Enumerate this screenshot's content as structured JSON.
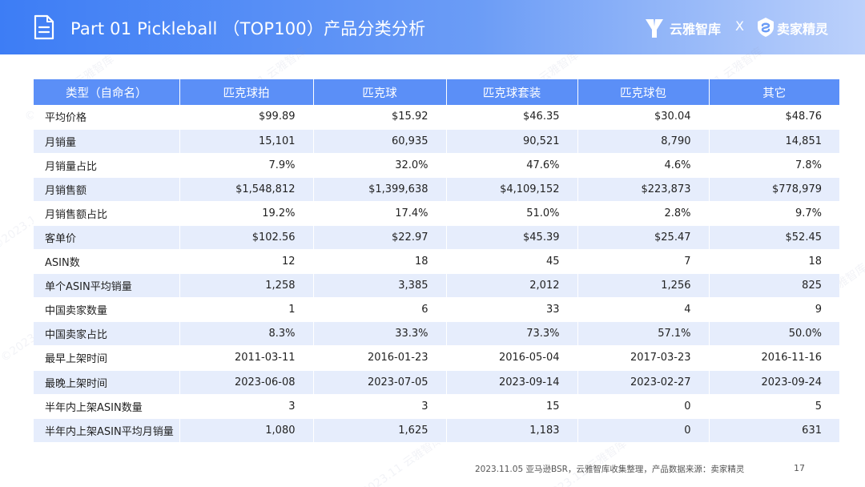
{
  "header": {
    "title": "Part 01 Pickleball （TOP100）产品分类分析",
    "brand_left": "云雅智库",
    "brand_sep": "X",
    "brand_right": "卖家精灵",
    "accent": "#3d7df5"
  },
  "watermark_text": "©2023.11 云雅智库",
  "table": {
    "header_color": "#5b8ff7",
    "stripe_color": "#e6edfc",
    "columns": [
      "类型（自命名）",
      "匹克球拍",
      "匹克球",
      "匹克球套装",
      "匹克球包",
      "其它"
    ],
    "rows": [
      {
        "label": "平均价格",
        "values": [
          "$99.89",
          "$15.92",
          "$46.35",
          "$30.04",
          "$48.76"
        ]
      },
      {
        "label": "月销量",
        "values": [
          "15,101",
          "60,935",
          "90,521",
          "8,790",
          "14,851"
        ]
      },
      {
        "label": "月销量占比",
        "values": [
          "7.9%",
          "32.0%",
          "47.6%",
          "4.6%",
          "7.8%"
        ]
      },
      {
        "label": "月销售额",
        "values": [
          "$1,548,812",
          "$1,399,638",
          "$4,109,152",
          "$223,873",
          "$778,979"
        ]
      },
      {
        "label": "月销售额占比",
        "values": [
          "19.2%",
          "17.4%",
          "51.0%",
          "2.8%",
          "9.7%"
        ]
      },
      {
        "label": "客单价",
        "values": [
          "$102.56",
          "$22.97",
          "$45.39",
          "$25.47",
          "$52.45"
        ]
      },
      {
        "label": "ASIN数",
        "values": [
          "12",
          "18",
          "45",
          "7",
          "18"
        ]
      },
      {
        "label": "单个ASIN平均销量",
        "values": [
          "1,258",
          "3,385",
          "2,012",
          "1,256",
          "825"
        ]
      },
      {
        "label": "中国卖家数量",
        "values": [
          "1",
          "6",
          "33",
          "4",
          "9"
        ]
      },
      {
        "label": "中国卖家占比",
        "values": [
          "8.3%",
          "33.3%",
          "73.3%",
          "57.1%",
          "50.0%"
        ]
      },
      {
        "label": "最早上架时间",
        "values": [
          "2011-03-11",
          "2016-01-23",
          "2016-05-04",
          "2017-03-23",
          "2016-11-16"
        ]
      },
      {
        "label": "最晚上架时间",
        "values": [
          "2023-06-08",
          "2023-07-05",
          "2023-09-14",
          "2023-02-27",
          "2023-09-24"
        ]
      },
      {
        "label": "半年内上架ASIN数量",
        "values": [
          "3",
          "3",
          "15",
          "0",
          "5"
        ]
      },
      {
        "label": "半年内上架ASIN平均月销量",
        "values": [
          "1,080",
          "1,625",
          "1,183",
          "0",
          "631"
        ]
      }
    ]
  },
  "footer": {
    "source_note": "2023.11.05 亚马逊BSR，云雅智库收集整理，产品数据来源：卖家精灵",
    "page_number": "17"
  }
}
